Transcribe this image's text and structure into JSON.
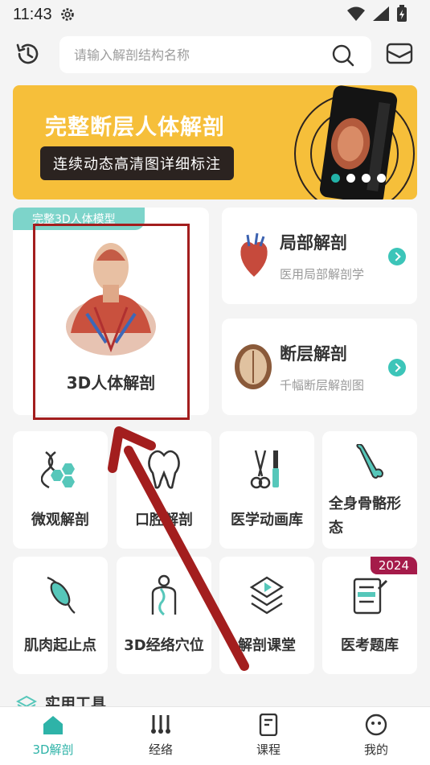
{
  "status_bar": {
    "time": "11:43"
  },
  "search": {
    "placeholder": "请输入解剖结构名称"
  },
  "banner": {
    "title": "完整断层人体解剖",
    "subtitle": "连续动态高清图详细标注",
    "dots": 4,
    "active_dot": 0
  },
  "featured": {
    "tag": "完整3D人体模型",
    "label": "3D人体解剖"
  },
  "side_cards": [
    {
      "title": "局部解剖",
      "subtitle": "医用局部解剖学",
      "icon": "heart-icon"
    },
    {
      "title": "断层解剖",
      "subtitle": "千幅断层解剖图",
      "icon": "brain-section-icon"
    }
  ],
  "grid": [
    {
      "label": "微观解剖",
      "icon": "dna-cell-icon"
    },
    {
      "label": "口腔解剖",
      "icon": "tooth-icon"
    },
    {
      "label": "医学动画库",
      "icon": "surgical-tools-icon"
    },
    {
      "label": "全身骨骼形态",
      "icon": "bone-icon"
    },
    {
      "label": "肌肉起止点",
      "icon": "muscle-icon"
    },
    {
      "label": "3D经络穴位",
      "icon": "meridian-body-icon"
    },
    {
      "label": "解剖课堂",
      "icon": "play-layers-icon"
    },
    {
      "label": "医考题库",
      "icon": "exam-notes-icon",
      "badge": "2024"
    }
  ],
  "tools": {
    "title": "实用工具"
  },
  "tabs": [
    {
      "label": "3D解剖",
      "active": true
    },
    {
      "label": "经络",
      "active": false
    },
    {
      "label": "课程",
      "active": false
    },
    {
      "label": "我的",
      "active": false
    }
  ],
  "colors": {
    "accent": "#2eb3a8",
    "banner": "#f6bf3a",
    "highlight": "#a31e1e"
  }
}
